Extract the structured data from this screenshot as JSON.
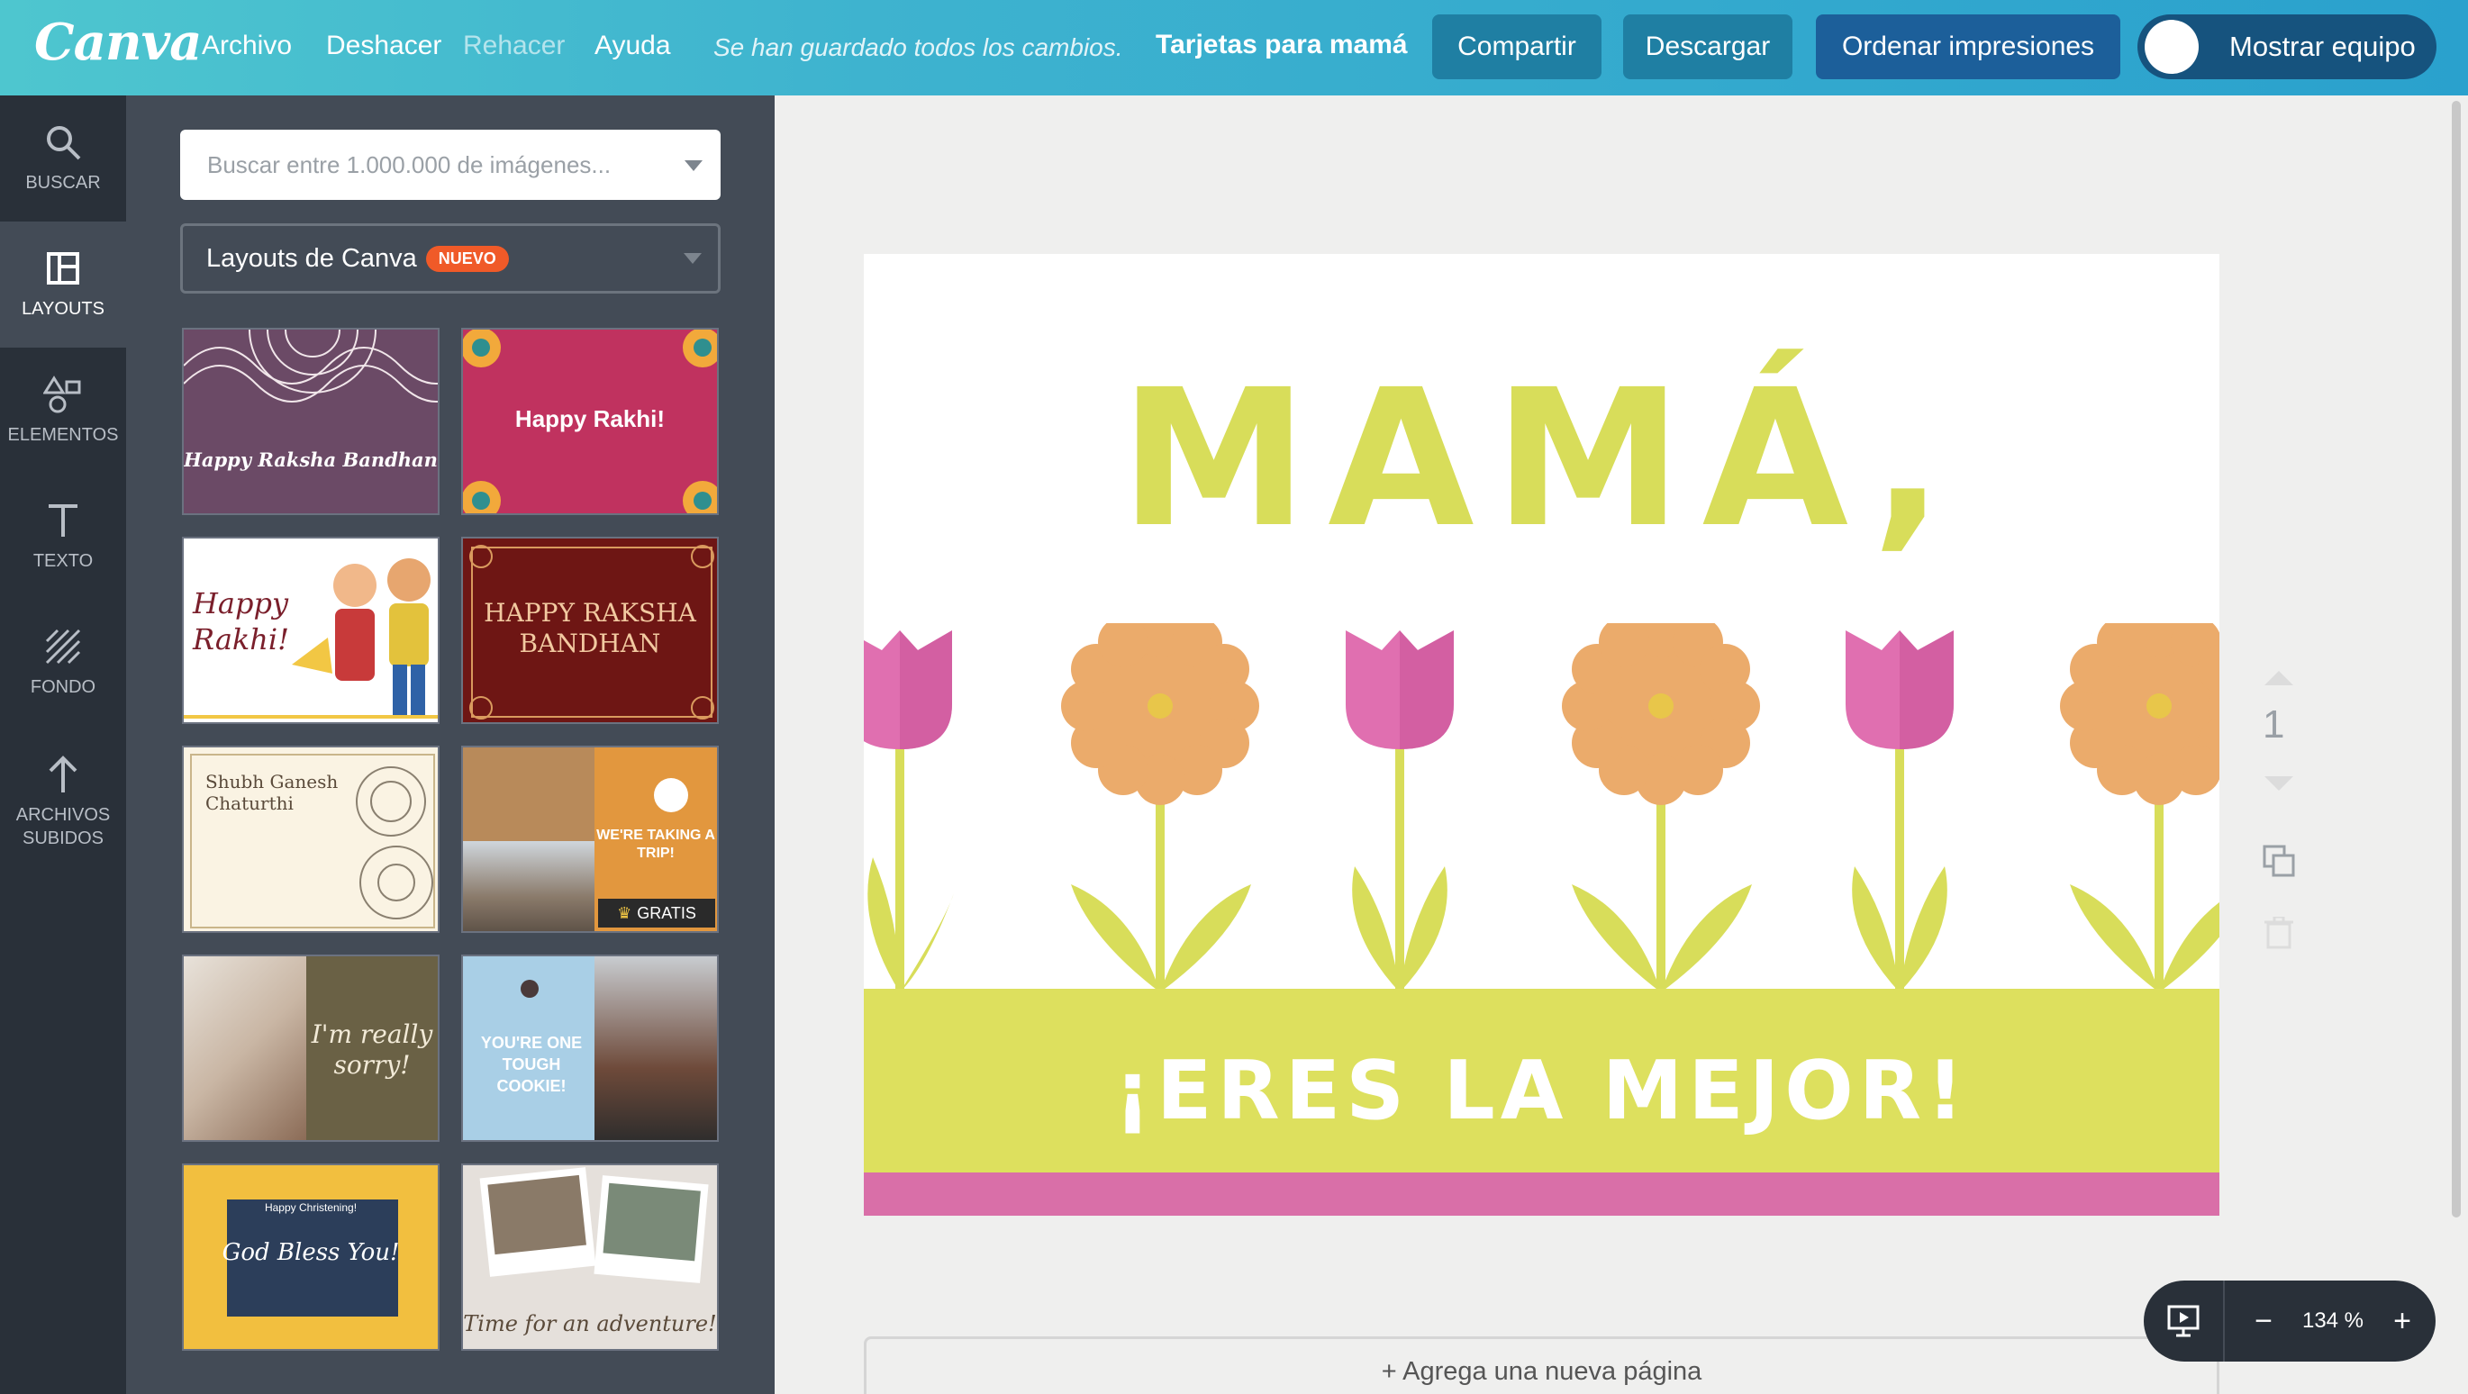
{
  "app": {
    "logo": "Canva"
  },
  "topbar": {
    "menu": [
      "Archivo",
      "Deshacer",
      "Rehacer",
      "Ayuda"
    ],
    "saved_message": "Se han guardado todos los cambios.",
    "document_title": "Tarjetas para mamá",
    "share_label": "Compartir",
    "download_label": "Descargar",
    "print_label": "Ordenar impresiones",
    "team_label": "Mostrar equipo"
  },
  "leftnav": {
    "items": [
      {
        "label": "BUSCAR",
        "icon": "search-icon"
      },
      {
        "label": "LAYOUTS",
        "icon": "layout-icon",
        "active": true
      },
      {
        "label": "ELEMENTOS",
        "icon": "shapes-icon"
      },
      {
        "label": "TEXTO",
        "icon": "text-icon"
      },
      {
        "label": "FONDO",
        "icon": "background-pattern-icon"
      },
      {
        "label": "ARCHIVOS SUBIDOS",
        "icon": "upload-arrow-icon"
      }
    ]
  },
  "panel": {
    "search_placeholder": "Buscar entre 1.000.000 de imágenes...",
    "layouts_label": "Layouts de Canva",
    "layouts_badge": "NUEVO",
    "thumbnails": [
      {
        "text": "Happy Raksha Bandhan",
        "bg": "#6b4a66"
      },
      {
        "text": "Happy Rakhi!",
        "bg": "#c0325f"
      },
      {
        "text": "Happy Rakhi!",
        "bg": "#ffffff"
      },
      {
        "text": "HAPPY RAKSHA BANDHAN",
        "bg": "#6e1614"
      },
      {
        "text": "Shubh Ganesh Chaturthi",
        "bg": "#faf3e3"
      },
      {
        "text": "WE'RE TAKING A TRIP!",
        "badge": "GRATIS",
        "bg": "#e2973e"
      },
      {
        "text": "I'm really sorry!",
        "bg": "#6a6145"
      },
      {
        "text": "YOU'RE ONE TOUGH COOKIE!",
        "bg": "#a9cfe6"
      },
      {
        "text": "God Bless You!",
        "small_text": "Happy Christening!",
        "bg": "#f2bf3f"
      },
      {
        "text": "Time for an adventure!",
        "bg": "#e5e0db"
      }
    ]
  },
  "canvas": {
    "title": "MAMÁ,",
    "subtitle": "¡ERES LA MEJOR!",
    "page_number": "1",
    "add_page_label": "+ Agrega una nueva página",
    "colors": {
      "title": "#d8dd5a",
      "band": "#dde05e",
      "pink": "#d96fa8",
      "flower": "#ebab6b",
      "tulip": "#e06fb0",
      "stem": "#d8dd5a"
    }
  },
  "zoom": {
    "value": "134 %",
    "minus": "−",
    "plus": "+"
  }
}
